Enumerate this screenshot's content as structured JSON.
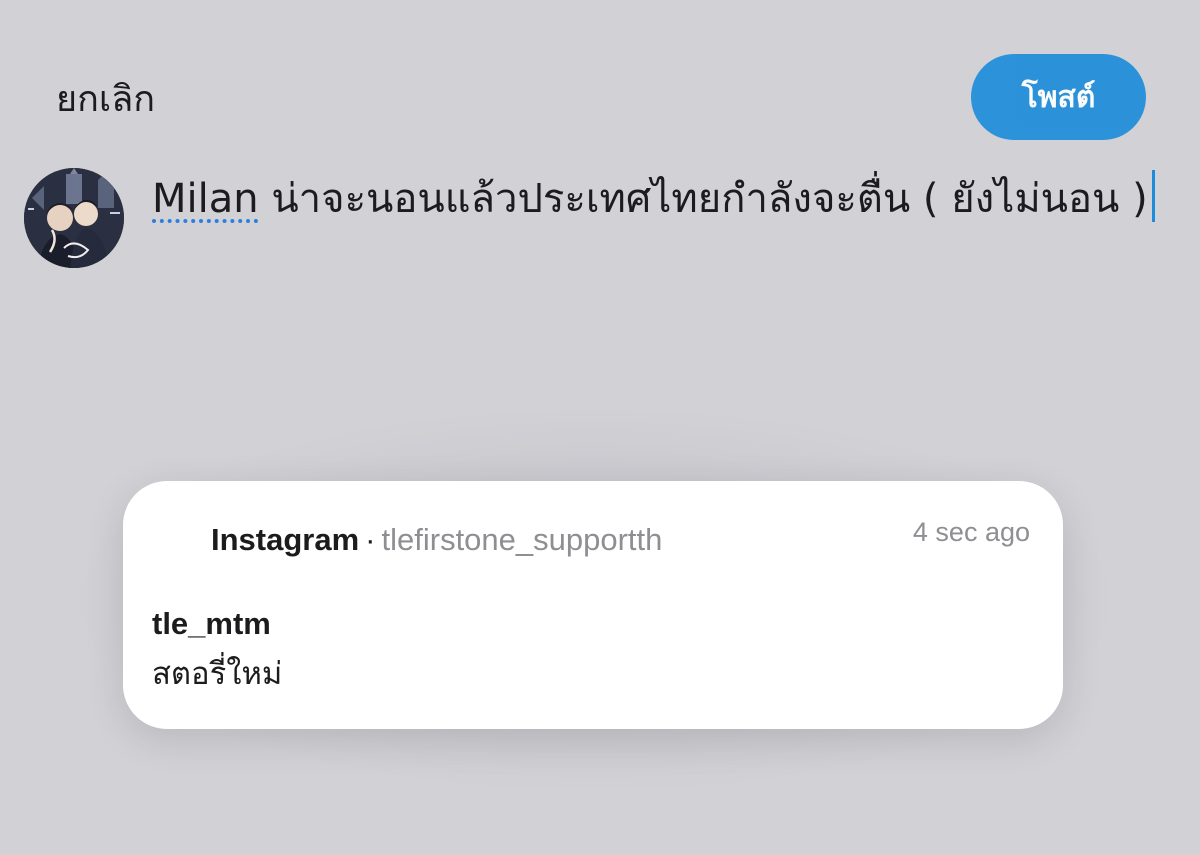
{
  "header": {
    "cancel_label": "ยกเลิก",
    "post_label": "โพสต์"
  },
  "composer": {
    "avatar_icon": "profile-avatar",
    "misspelled_word": "Milan",
    "text": " น่าจะนอนแล้วประเทศไทยกำลังจะตื่น ( ยังไม่นอน )"
  },
  "notification": {
    "app_name": "Instagram",
    "separator": "·",
    "account": "tlefirstone_supportth",
    "time": "4 sec ago",
    "title": "tle_mtm",
    "body": "สตอรี่ใหม่"
  },
  "colors": {
    "background": "#d1d1d6",
    "accent": "#1d8ddb",
    "banner": "#ffffff",
    "secondary_text": "#8e8e93"
  }
}
